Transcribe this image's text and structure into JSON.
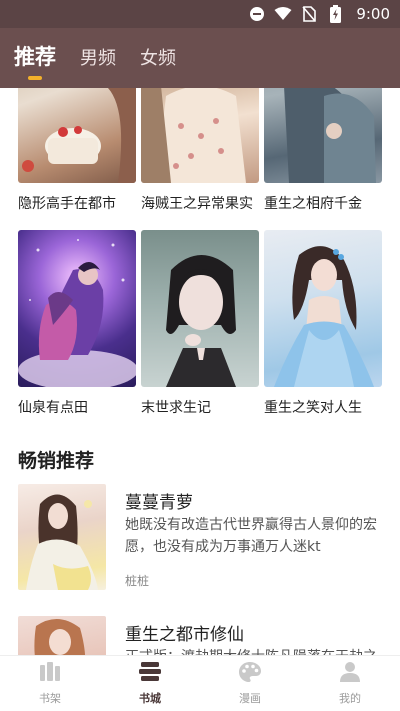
{
  "status_bar": {
    "time": "9:00"
  },
  "tabs": [
    {
      "label": "推荐",
      "active": true
    },
    {
      "label": "男频",
      "active": false
    },
    {
      "label": "女频",
      "active": false
    }
  ],
  "grid": {
    "row1": [
      {
        "title": "隐形高手在都市"
      },
      {
        "title": "海贼王之异常果实"
      },
      {
        "title": "重生之相府千金"
      }
    ],
    "row2": [
      {
        "title": "仙泉有点田"
      },
      {
        "title": "末世求生记"
      },
      {
        "title": "重生之笑对人生"
      }
    ]
  },
  "section": {
    "title": "畅销推荐"
  },
  "list": [
    {
      "title": "蔓蔓青萝",
      "desc": "她既没有改造古代世界赢得古人景仰的宏愿，也没有成为万事通万人迷kt",
      "author": "桩桩"
    },
    {
      "title": "重生之都市修仙",
      "desc": "正式版：渡劫期大修士陈凡陨落在天劫之下，却意外重生回到地球",
      "author": ""
    }
  ],
  "bottom_nav": [
    {
      "label": "书架",
      "icon": "bookshelf-icon",
      "active": false
    },
    {
      "label": "书城",
      "icon": "bookstore-icon",
      "active": true
    },
    {
      "label": "漫画",
      "icon": "palette-icon",
      "active": false
    },
    {
      "label": "我的",
      "icon": "profile-icon",
      "active": false
    }
  ],
  "colors": {
    "status_bar": "#5b4445",
    "top_bar": "#6b4f4f",
    "tab_indicator": "#f3b12b",
    "nav_active": "#4a3838",
    "nav_inactive": "#9a9a9a"
  }
}
